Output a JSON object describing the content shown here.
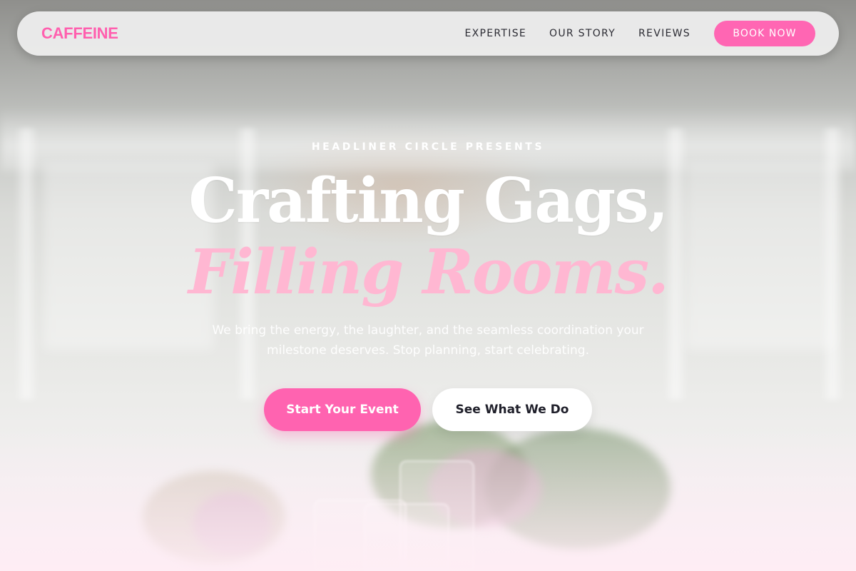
{
  "nav": {
    "brand": "CAFFEINE",
    "links": [
      "EXPERTISE",
      "OUR STORY",
      "REVIEWS"
    ],
    "book_label": "BOOK NOW"
  },
  "hero": {
    "eyebrow": "HEADLINER CIRCLE PRESENTS",
    "title_line1": "Crafting Gags,",
    "title_line2": "Filling Rooms.",
    "subtitle": "We bring the energy, the laughter, and the seamless coordination your milestone deserves. Stop planning, start celebrating.",
    "cta_primary": "Start Your Event",
    "cta_secondary": "See What We Do"
  },
  "colors": {
    "brand_pink": "#ff5fae",
    "accent_pink": "#ff66b3",
    "title_pink": "#ffb7d2",
    "nav_text": "#2b2b33"
  }
}
